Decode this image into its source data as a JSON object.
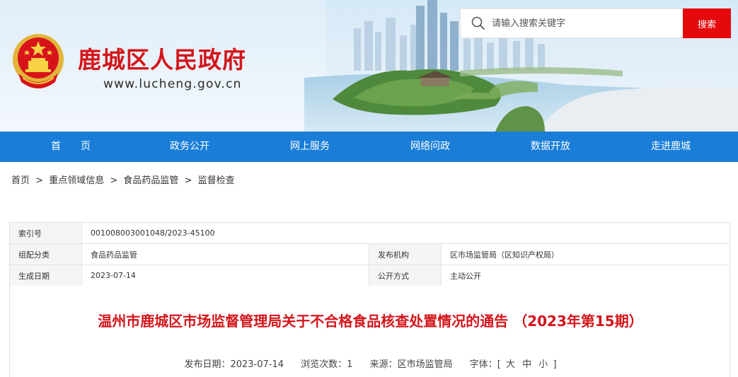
{
  "header": {
    "site_title": "鹿城区人民政府",
    "site_url": "www.lucheng.gov.cn",
    "search": {
      "placeholder": "请输入搜索关键字",
      "button_label": "搜索"
    }
  },
  "nav": {
    "items": [
      {
        "label": "首　　页"
      },
      {
        "label": "政务公开"
      },
      {
        "label": "网上服务"
      },
      {
        "label": "网络问政"
      },
      {
        "label": "数据开放"
      },
      {
        "label": "走进鹿城"
      }
    ]
  },
  "breadcrumb": {
    "items": [
      "首页",
      "重点领域信息",
      "食品药品监管",
      "监督检查"
    ],
    "separator": ">"
  },
  "meta": {
    "index_label": "索引号",
    "index_value": "001008003001048/2023-45100",
    "category_label": "组配分类",
    "category_value": "食品药品监管",
    "publisher_label": "发布机构",
    "publisher_value": "区市场监管局（区知识产权局）",
    "date_label": "生成日期",
    "date_value": "2023-07-14",
    "disclosure_label": "公开方式",
    "disclosure_value": "主动公开"
  },
  "article": {
    "title": "温州市鹿城区市场监督管理局关于不合格食品核查处置情况的通告 （2023年第15期）",
    "publish_date": "发布日期：2023-07-14",
    "views": "浏览次数：1",
    "source": "来源：区市场监管局",
    "font_label": "字体：[",
    "font_large": "大",
    "font_medium": "中",
    "font_small": "小",
    "font_close": "]"
  },
  "colors": {
    "brand_red": "#d4151b",
    "nav_blue": "#1a7ed8",
    "search_red": "#e5080d"
  }
}
